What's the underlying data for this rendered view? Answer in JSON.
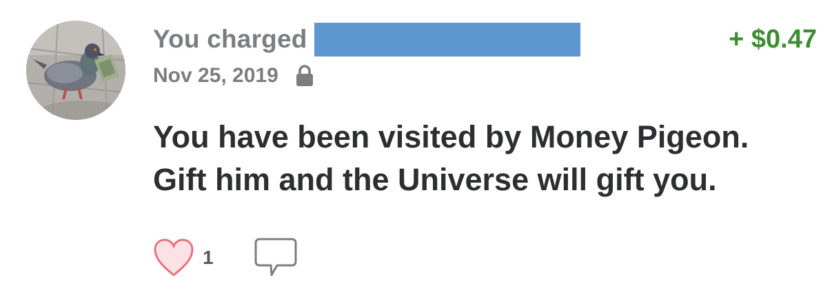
{
  "transaction": {
    "action": "You charged",
    "amount": "+ $0.47",
    "date": "Nov 25, 2019",
    "note_line1": "You have been visited by Money Pigeon.",
    "note_line2": "Gift him and the Universe will gift you."
  },
  "actions": {
    "like_count": "1"
  },
  "icons": {
    "privacy": "lock-icon",
    "like": "heart-icon",
    "comment": "comment-icon"
  },
  "colors": {
    "amount": "#3d8d2e",
    "redaction": "#5d97cf",
    "heart_fill": "#fde2e5",
    "heart_stroke": "#e8717f"
  }
}
